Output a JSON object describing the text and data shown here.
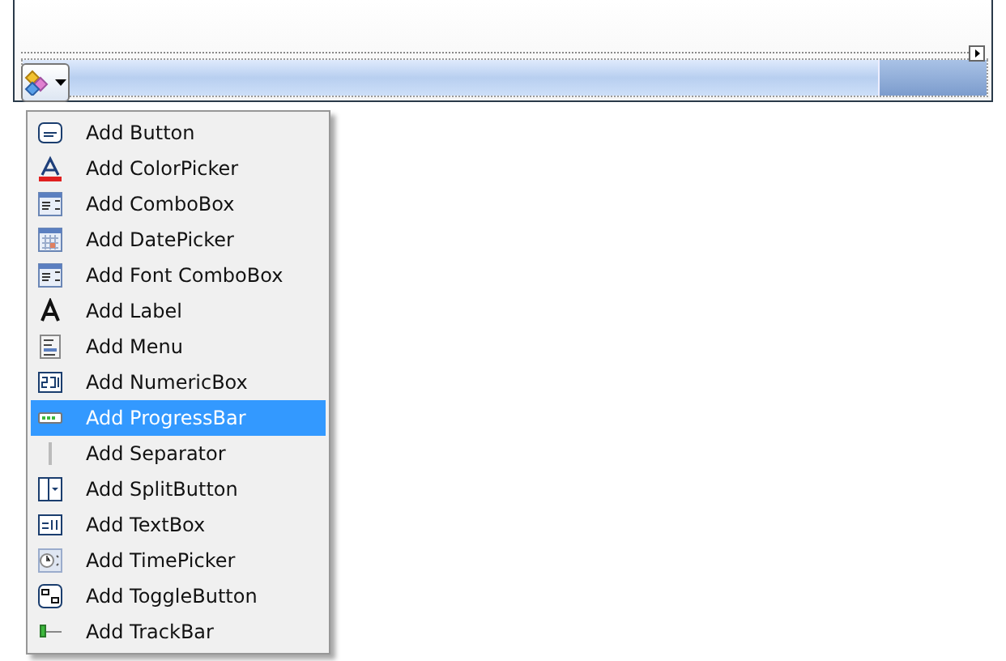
{
  "menu": {
    "items": [
      {
        "kind": "button",
        "label": "Add Button",
        "selected": false
      },
      {
        "kind": "colorpicker",
        "label": "Add ColorPicker",
        "selected": false
      },
      {
        "kind": "combobox",
        "label": "Add ComboBox",
        "selected": false
      },
      {
        "kind": "datepicker",
        "label": "Add DatePicker",
        "selected": false
      },
      {
        "kind": "combobox",
        "label": "Add Font ComboBox",
        "selected": false
      },
      {
        "kind": "label",
        "label": "Add Label",
        "selected": false
      },
      {
        "kind": "menu",
        "label": "Add Menu",
        "selected": false
      },
      {
        "kind": "numeric",
        "label": "Add NumericBox",
        "selected": false
      },
      {
        "kind": "progress",
        "label": "Add ProgressBar",
        "selected": true
      },
      {
        "kind": "separator",
        "label": "Add Separator",
        "selected": false
      },
      {
        "kind": "splitbutton",
        "label": "Add SplitButton",
        "selected": false
      },
      {
        "kind": "textbox",
        "label": "Add TextBox",
        "selected": false
      },
      {
        "kind": "timepicker",
        "label": "Add TimePicker",
        "selected": false
      },
      {
        "kind": "toggle",
        "label": "Add ToggleButton",
        "selected": false
      },
      {
        "kind": "trackbar",
        "label": "Add TrackBar",
        "selected": false
      }
    ]
  }
}
